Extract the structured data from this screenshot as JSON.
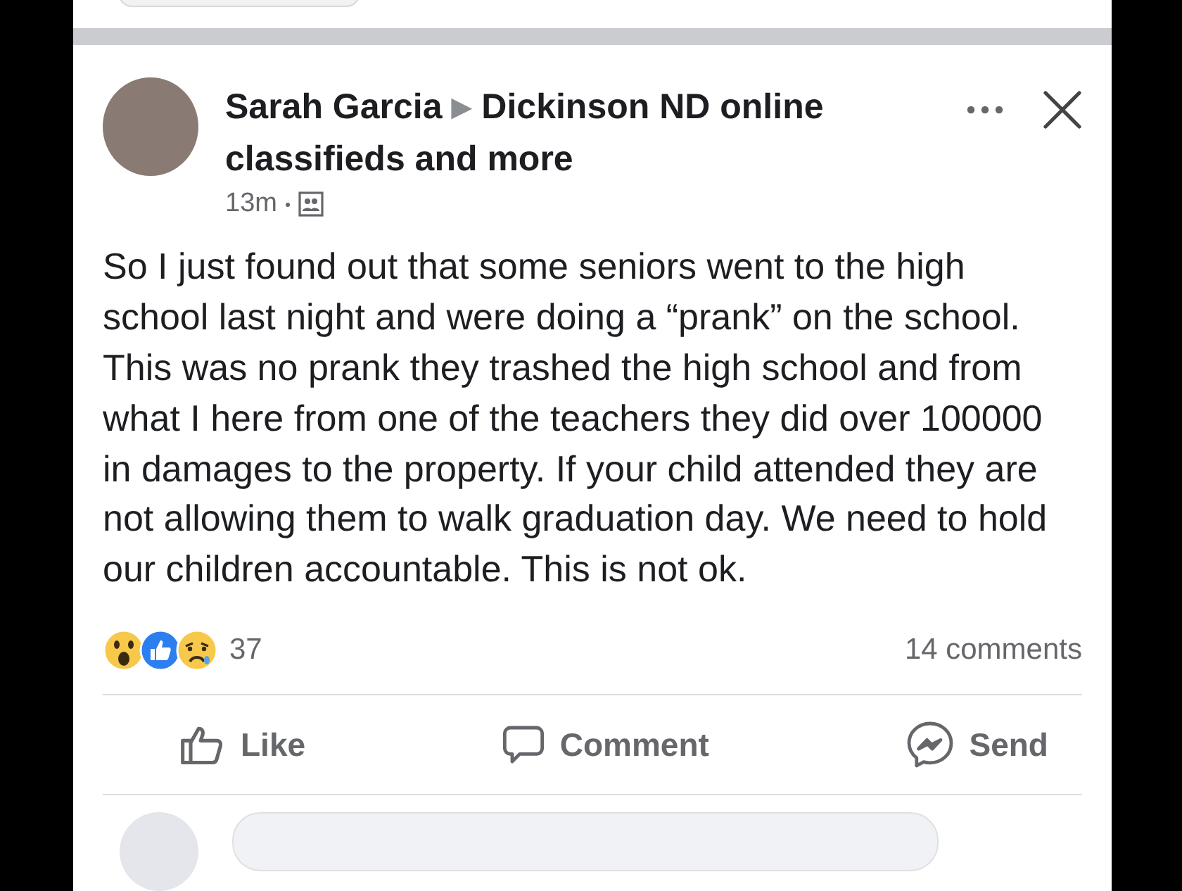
{
  "post": {
    "author": "Sarah Garcia",
    "arrow": "▶",
    "group": "Dickinson ND online classifieds and more",
    "time": "13m",
    "body": "So I just found out that some seniors went to the high school last night and were doing a “prank” on the school. This was no prank they trashed the high school and from what I here from one of the teachers they did over 100000 in damages to the property. If your child attended they are not allowing them to walk graduation day. We need to hold our children accountable. This is not ok.",
    "reactions_count": "37",
    "comments_count": "14 comments"
  },
  "actions": [
    {
      "kind": "like",
      "label": "Like"
    },
    {
      "kind": "comment",
      "label": "Comment"
    },
    {
      "kind": "send",
      "label": "Send"
    }
  ]
}
